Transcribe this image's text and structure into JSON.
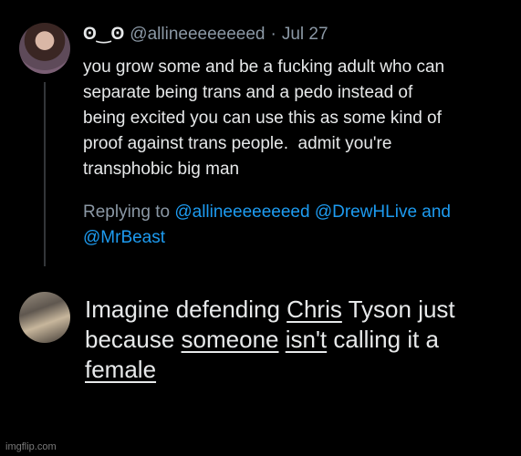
{
  "tweet": {
    "display_name": "ʘ‿ʘ",
    "handle": "@allineeeeeeeed",
    "separator": "·",
    "date": "Jul 27",
    "text": "you grow some and be a fucking adult who can\nseparate being trans and a pedo instead of\nbeing excited you can use this as some kind of\nproof against trans people.  admit you're\ntransphobic big man",
    "replying_prefix": "Replying to",
    "replying_to": [
      "@allineeeeeeeed",
      "@DrewHLive",
      "@MrBeast"
    ],
    "replying_and": "and"
  },
  "reply": {
    "text_parts": [
      {
        "text": "Imagine defending ",
        "underline": false
      },
      {
        "text": "Chris",
        "underline": true
      },
      {
        "text": " Tyson just\nbecause ",
        "underline": false
      },
      {
        "text": "someone",
        "underline": true
      },
      {
        "text": " ",
        "underline": false
      },
      {
        "text": "isn't",
        "underline": true
      },
      {
        "text": " calling it a\n",
        "underline": false
      },
      {
        "text": "female",
        "underline": true
      }
    ]
  },
  "watermark": "imgflip.com",
  "colors": {
    "background": "#000000",
    "text": "#e7e9ea",
    "secondary": "#8b98a5",
    "link": "#1d9bf0"
  }
}
